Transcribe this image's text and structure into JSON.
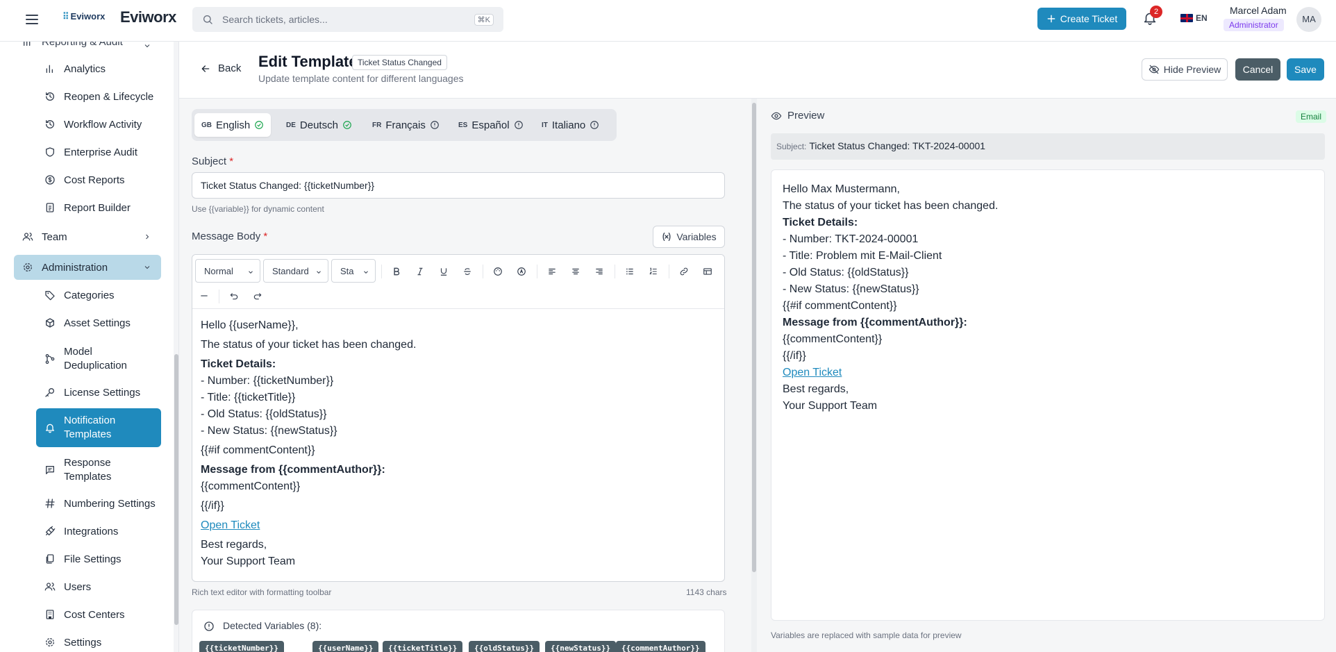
{
  "app": {
    "brand_small": "Eviworx",
    "brand": "Eviworx"
  },
  "topbar": {
    "search_placeholder": "Search tickets, articles...",
    "search_shortcut": "⌘K",
    "create_ticket": "Create Ticket",
    "notification_count": "2",
    "language": "EN",
    "user_name": "Marcel Adam",
    "user_role": "Administrator",
    "user_initials": "MA"
  },
  "sidebar": {
    "partial_header": "Reporting & Audit",
    "reporting_items": [
      {
        "label": "Analytics",
        "icon": "bar-chart-icon"
      },
      {
        "label": "Reopen & Lifecycle",
        "icon": "history-icon"
      },
      {
        "label": "Workflow Activity",
        "icon": "history-icon"
      },
      {
        "label": "Enterprise Audit",
        "icon": "shield-icon"
      },
      {
        "label": "Cost Reports",
        "icon": "dollar-circle-icon"
      },
      {
        "label": "Report Builder",
        "icon": "file-list-icon"
      }
    ],
    "team": "Team",
    "administration": "Administration",
    "admin_items": [
      {
        "label": "Categories",
        "icon": "tag-icon"
      },
      {
        "label": "Asset Settings",
        "icon": "box-icon"
      },
      {
        "label": "Model Deduplication",
        "icon": "merge-icon"
      },
      {
        "label": "License Settings",
        "icon": "key-icon"
      },
      {
        "label": "Notification Templates",
        "icon": "bell-icon"
      },
      {
        "label": "Response Templates",
        "icon": "message-square-icon"
      },
      {
        "label": "Numbering Settings",
        "icon": "hash-icon"
      },
      {
        "label": "Integrations",
        "icon": "plug-icon"
      },
      {
        "label": "File Settings",
        "icon": "files-icon"
      },
      {
        "label": "Users",
        "icon": "users-icon"
      },
      {
        "label": "Cost Centers",
        "icon": "building-icon"
      },
      {
        "label": "Settings",
        "icon": "gear-icon"
      }
    ]
  },
  "header": {
    "back": "Back",
    "title": "Edit Template",
    "badge": "Ticket Status Changed",
    "subtitle": "Update template content for different languages",
    "hide_preview": "Hide Preview",
    "cancel": "Cancel",
    "save": "Save"
  },
  "languages": [
    {
      "code": "GB",
      "label": "English",
      "status": "complete"
    },
    {
      "code": "DE",
      "label": "Deutsch",
      "status": "complete"
    },
    {
      "code": "FR",
      "label": "Français",
      "status": "missing"
    },
    {
      "code": "ES",
      "label": "Español",
      "status": "missing"
    },
    {
      "code": "IT",
      "label": "Italiano",
      "status": "missing"
    }
  ],
  "form": {
    "subject_label": "Subject",
    "required_mark": "*",
    "subject_value": "Ticket Status Changed: {{ticketNumber}}",
    "subject_hint": "Use {{variable}} for dynamic content",
    "body_label": "Message Body",
    "variables_button": "Variables",
    "toolbar": {
      "heading": "Normal",
      "font": "Standard",
      "size": "Sta"
    },
    "body_lines": [
      "Hello {{userName}},",
      "The status of your ticket has been changed.",
      "Ticket Details:",
      "- Number: {{ticketNumber}}",
      "- Title: {{ticketTitle}}",
      "- Old Status: {{oldStatus}}",
      "- New Status: {{newStatus}}",
      "{{#if commentContent}}",
      "Message from {{commentAuthor}}:",
      "{{commentContent}}",
      "{{/if}}",
      "Open Ticket",
      "Best regards,",
      "Your Support Team"
    ],
    "editor_hint": "Rich text editor with formatting toolbar",
    "char_count": "1143 chars",
    "detected_title": "Detected Variables (8):",
    "detected_vars": [
      "{{ticketNumber}}",
      "{{userName}}",
      "{{ticketTitle}}",
      "{{oldStatus}}",
      "{{newStatus}}",
      "{{commentAuthor}}"
    ]
  },
  "preview": {
    "title": "Preview",
    "type_badge": "Email",
    "subject_key": "Subject:",
    "subject_value": "Ticket Status Changed: TKT-2024-00001",
    "lines": [
      "Hello Max Mustermann,",
      "The status of your ticket has been changed.",
      "Ticket Details:",
      "- Number: TKT-2024-00001",
      "- Title: Problem mit E-Mail-Client",
      "- Old Status: {{oldStatus}}",
      "- New Status: {{newStatus}}",
      "{{#if commentContent}}",
      "Message from {{commentAuthor}}:",
      "{{commentContent}}",
      "{{/if}}",
      "Open Ticket",
      "Best regards,",
      "Your Support Team"
    ],
    "footnote": "Variables are replaced with sample data for preview"
  },
  "colors": {
    "primary": "#1f8abd",
    "secondary": "#4b5d66",
    "admin_bg": "#b9d9e8",
    "success": "#16a34a"
  }
}
